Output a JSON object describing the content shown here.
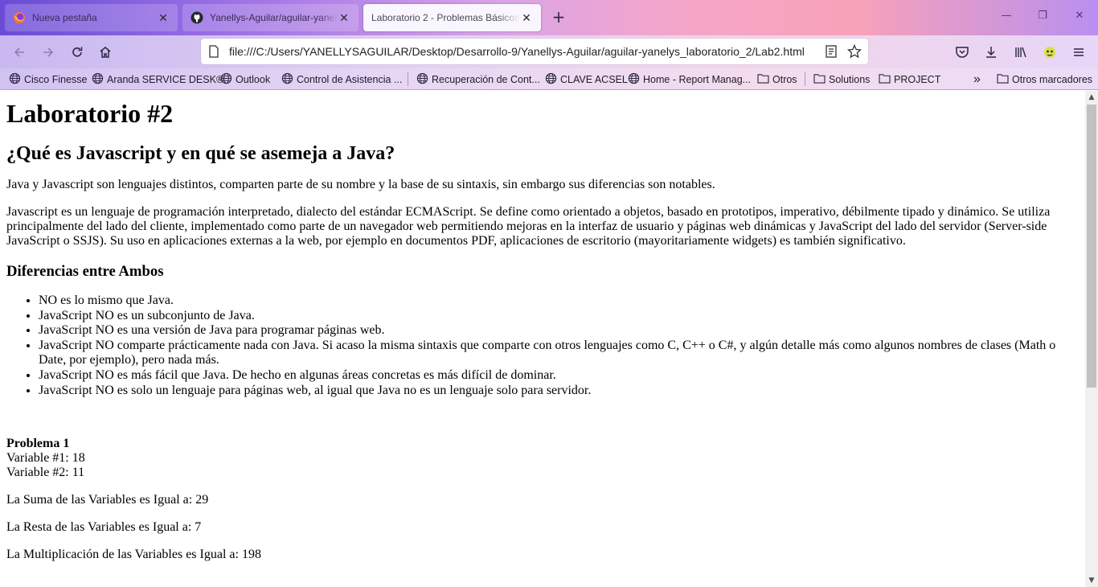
{
  "browser": {
    "tabs": [
      {
        "title": "Nueva pestaña",
        "favicon": "firefox-icon",
        "active": false
      },
      {
        "title": "Yanellys-Aguilar/aguilar-yanelys_laboratorio_2",
        "favicon": "github-icon",
        "active": false
      },
      {
        "title": "Laboratorio 2 - Problemas Básicos de JavaScript",
        "favicon": "none",
        "active": true
      }
    ],
    "new_tab_label": "+",
    "url": "file:///C:/Users/YANELLYSAGUILAR/Desktop/Desarrollo-9/Yanellys-Aguilar/aguilar-yanelys_laboratorio_2/Lab2.html",
    "bookmarks": [
      {
        "label": "Cisco Finesse",
        "icon": "globe-icon"
      },
      {
        "label": "Aranda SERVICE DESK®",
        "icon": "globe-icon"
      },
      {
        "label": "Outlook",
        "icon": "globe-icon"
      },
      {
        "label": "Control de Asistencia ...",
        "icon": "globe-icon"
      },
      {
        "label": "Recuperación de Cont...",
        "icon": "globe-icon"
      },
      {
        "label": "CLAVE ACSEL",
        "icon": "globe-icon"
      },
      {
        "label": "Home - Report Manag...",
        "icon": "globe-icon"
      },
      {
        "label": "Otros",
        "icon": "folder-icon"
      },
      {
        "label": "Solutions",
        "icon": "folder-icon"
      },
      {
        "label": "PROJECT",
        "icon": "folder-icon"
      }
    ],
    "overflow_label": "»",
    "other_bookmarks": "Otros marcadores"
  },
  "page": {
    "h1": "Laboratorio #2",
    "h2": "¿Qué es Javascript y en qué se asemeja a Java?",
    "p1": "Java y Javascript son lenguajes distintos, comparten parte de su nombre y la base de su sintaxis, sin embargo sus diferencias son notables.",
    "p2": "Javascript es un lenguaje de programación interpretado, dialecto del estándar ECMAScript. Se define como orientado a objetos, basado en prototipos, imperativo, débilmente tipado y dinámico. Se utiliza principalmente del lado del cliente, implementado como parte de un navegador web permitiendo mejoras en la interfaz de usuario y páginas web dinámicas y JavaScript del lado del servidor (Server-side JavaScript o SSJS). Su uso en aplicaciones externas a la web, por ejemplo en documentos PDF, aplicaciones de escritorio (mayoritariamente widgets) es también significativo.",
    "h3": "Diferencias entre Ambos",
    "list": [
      "NO es lo mismo que Java.",
      "JavaScript NO es un subconjunto de Java.",
      "JavaScript NO es una versión de Java para programar páginas web.",
      "JavaScript NO comparte prácticamente nada con Java. Si acaso la misma sintaxis que comparte con otros lenguajes como C, C++ o C#, y algún detalle más como algunos nombres de clases (Math o Date, por ejemplo), pero nada más.",
      "JavaScript NO es más fácil que Java. De hecho en algunas áreas concretas es más difícil de dominar.",
      "JavaScript NO es solo un lenguaje para páginas web, al igual que Java no es un lenguaje solo para servidor."
    ],
    "problem_title": "Problema 1",
    "var1": "Variable #1: 18",
    "var2": "Variable #2: 11",
    "sum": "La Suma de las Variables es Igual a: 29",
    "diff": "La Resta de las Variables es Igual a: 7",
    "mult": "La Multiplicación de las Variables es Igual a: 198"
  }
}
